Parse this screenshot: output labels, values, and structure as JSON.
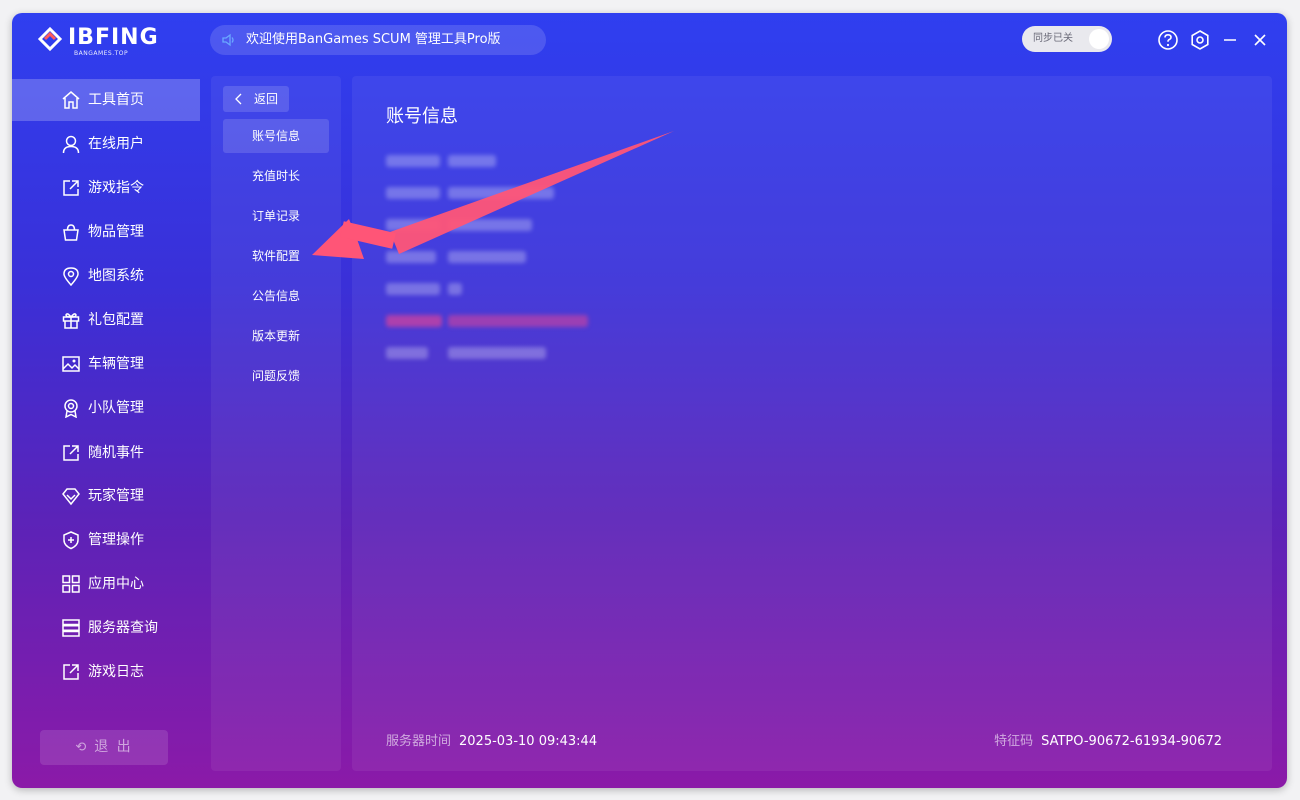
{
  "header": {
    "logo_text": "IBFING",
    "logo_sub": "BANGAMES.TOP",
    "announcement": "欢迎使用BanGames SCUM 管理工具Pro版",
    "sync_toggle_label": "同步已关"
  },
  "sidebar": {
    "items": [
      {
        "label": "工具首页",
        "icon": "home-icon"
      },
      {
        "label": "在线用户",
        "icon": "user-icon"
      },
      {
        "label": "游戏指令",
        "icon": "command-icon"
      },
      {
        "label": "物品管理",
        "icon": "bag-icon"
      },
      {
        "label": "地图系统",
        "icon": "map-pin-icon"
      },
      {
        "label": "礼包配置",
        "icon": "gift-icon"
      },
      {
        "label": "车辆管理",
        "icon": "image-icon"
      },
      {
        "label": "小队管理",
        "icon": "badge-icon"
      },
      {
        "label": "随机事件",
        "icon": "event-icon"
      },
      {
        "label": "玩家管理",
        "icon": "diamond-icon"
      },
      {
        "label": "管理操作",
        "icon": "shield-icon"
      },
      {
        "label": "应用中心",
        "icon": "grid-icon"
      },
      {
        "label": "服务器查询",
        "icon": "server-icon"
      },
      {
        "label": "游戏日志",
        "icon": "log-icon"
      }
    ],
    "logout_label": "退 出"
  },
  "subnav": {
    "back_label": "返回",
    "items": [
      "账号信息",
      "充值时长",
      "订单记录",
      "软件配置",
      "公告信息",
      "版本更新",
      "问题反馈"
    ]
  },
  "content": {
    "title": "账号信息"
  },
  "footer": {
    "server_time_label": "服务器时间",
    "server_time_value": "2025-03-10 09:43:44",
    "feature_code_label": "特征码",
    "feature_code_value": "SATPO-90672-61934-90672"
  },
  "colors": {
    "accent_arrow": "#ff4f72",
    "window_top": "#2f3ff0",
    "window_bottom": "#8b1aa8"
  }
}
